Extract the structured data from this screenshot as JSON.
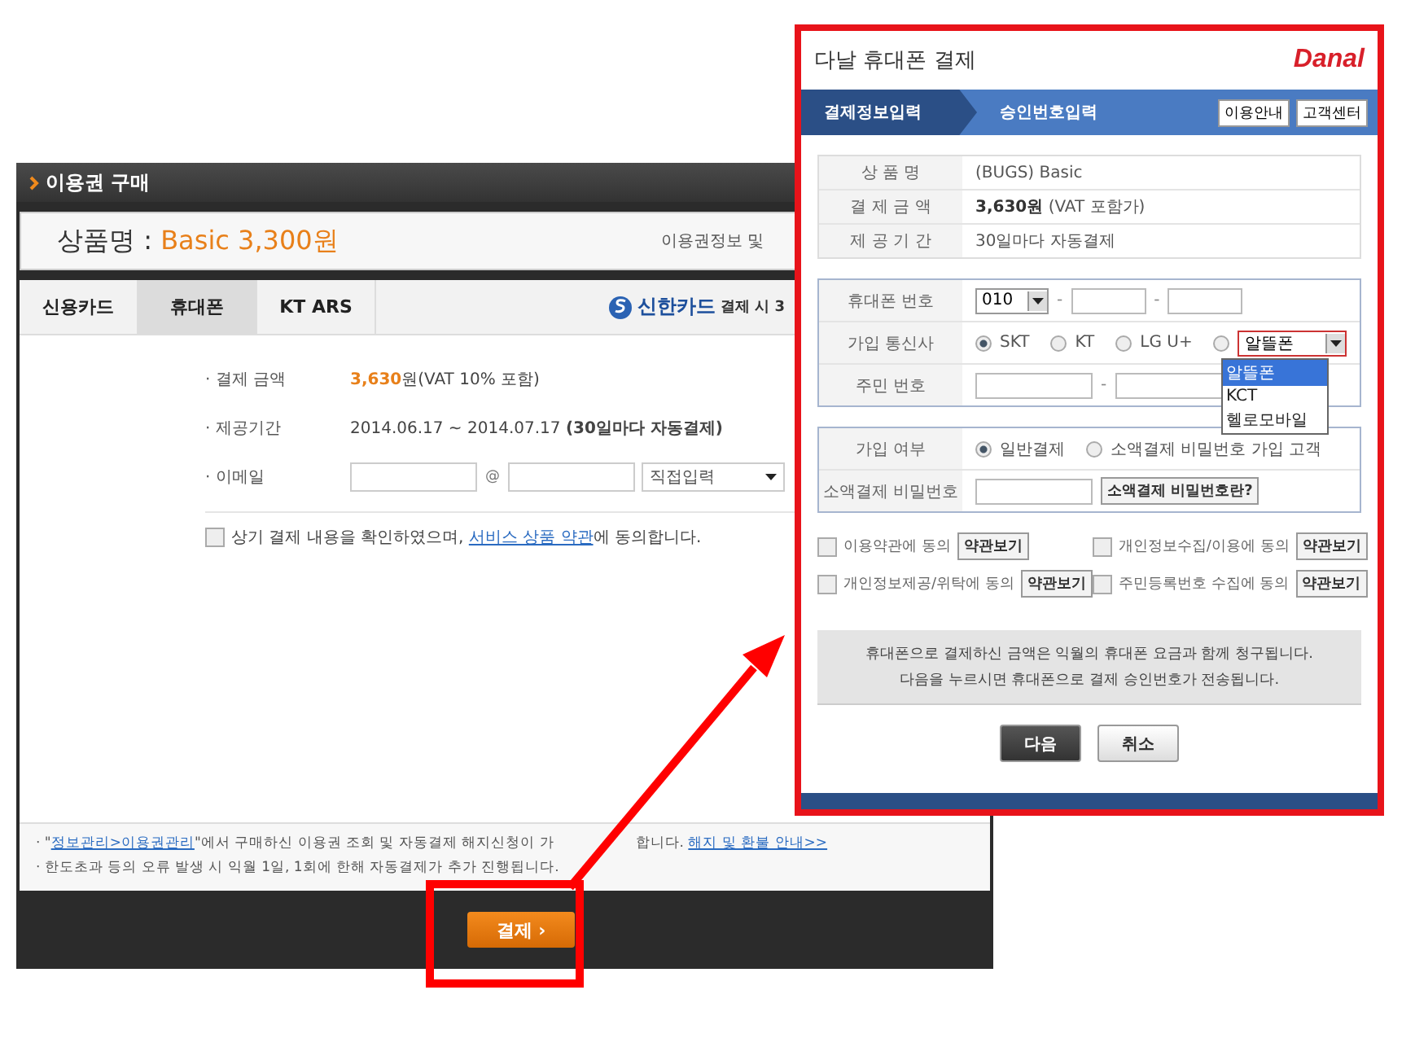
{
  "purchase_window": {
    "title": "이용권 구매",
    "product_label": "상품명 :",
    "product_value": "Basic 3,300원",
    "info_link": "이용권정보 및",
    "tabs": [
      {
        "label": "신용카드",
        "selected": false
      },
      {
        "label": "휴대폰",
        "selected": true
      },
      {
        "label": "KT ARS",
        "selected": false
      }
    ],
    "promo_card": "신한카드",
    "promo_note": "결제 시 3",
    "rows": [
      {
        "kind": "text",
        "label": "· 결제 금액",
        "value": "**3,630**원(VAT 10% 포함)"
      },
      {
        "kind": "text",
        "label": "· 제공기간",
        "value": "2014.06.17 ~ 2014.07.17 **(30일마다 자동결제)**"
      },
      {
        "kind": "email",
        "label": "· 이메일",
        "at": "@",
        "domain_select": "직접입력"
      }
    ],
    "agreement": {
      "checked": false,
      "before": "상기 결제 내용을 확인하였으며, ",
      "link": "서비스 상품 약관",
      "after": "에 동의합니다."
    },
    "notes": [
      {
        "before": "· \"",
        "link": "정보관리>이용권관리",
        "after": "\"에서 구매하신 이용권 조회 및 자동결제 해지신청이 가",
        "tail": "합니다.",
        "link2": "해지 및 환불 안내>>"
      },
      {
        "before": "· 한도초과 등의 오류 발생 시 익월 1일, 1회에 한해 자동결제가 추가 진행됩니다."
      }
    ],
    "pay_button": "결제 ›"
  },
  "payment_popup": {
    "title": "다날 휴대폰 결제",
    "logo": "Danal",
    "steps": [
      {
        "label": "결제정보입력",
        "selected": true
      },
      {
        "label": "승인번호입력",
        "selected": false
      }
    ],
    "header_buttons": [
      "이용안내",
      "고객센터"
    ],
    "summary": [
      {
        "label": "상 품 명",
        "value": "(BUGS) Basic"
      },
      {
        "label": "결 제 금 액",
        "value": "**3,630원** (VAT 포함가)"
      },
      {
        "label": "제 공 기 간",
        "value": "30일마다 자동결제"
      }
    ],
    "phone_label": "휴대폰 번호",
    "phone_prefix": "010",
    "separator": "-",
    "carrier_label": "가입 통신사",
    "carriers": [
      {
        "label": "SKT",
        "selected": true
      },
      {
        "label": "KT",
        "selected": false
      },
      {
        "label": "LG U+",
        "selected": false
      }
    ],
    "mvno": {
      "selected": false,
      "value": "알뜰폰",
      "expanded": true,
      "options": [
        {
          "label": "알뜰폰",
          "selected": true
        },
        {
          "label": "KCT",
          "selected": false
        },
        {
          "label": "헬로모바일",
          "selected": false
        }
      ]
    },
    "id_label": "주민 번호",
    "membership_label": "가입 여부",
    "membership_options": [
      {
        "label": "일반결제",
        "selected": true
      },
      {
        "label": "소액결제 비밀번호 가입 고객",
        "selected": false
      }
    ],
    "password_label": "소액결제 비밀번호",
    "password_help": "소액결제 비밀번호란?",
    "agreements": [
      {
        "label": "이용약관에 동의",
        "checked": false,
        "button": "약관보기"
      },
      {
        "label": "개인정보수집/이용에 동의",
        "checked": false,
        "button": "약관보기"
      },
      {
        "label": "개인정보제공/위탁에 동의",
        "checked": false,
        "button": "약관보기"
      },
      {
        "label": "주민등록번호 수집에 동의",
        "checked": false,
        "button": "약관보기"
      }
    ],
    "notice": [
      "휴대폰으로 결제하신 금액은 익월의 휴대폰 요금과 함께 청구됩니다.",
      "다음을 누르시면 휴대폰으로 결제 승인번호가 전송됩니다."
    ],
    "next_button": "다음",
    "cancel_button": "취소"
  }
}
